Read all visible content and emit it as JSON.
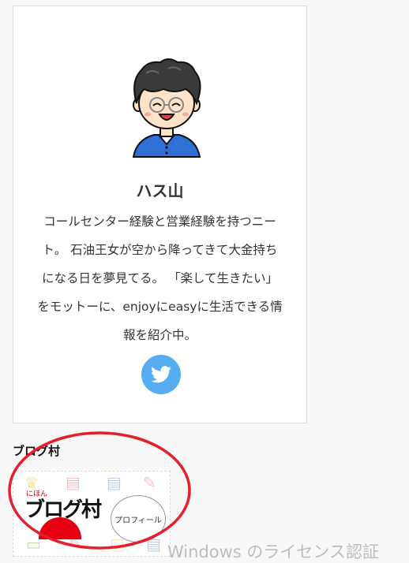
{
  "profile": {
    "name": "ハス山",
    "bio_lines": [
      "コールセンター経験と営業経験を持つニー",
      "ト。 石油王女が空から降ってきて大金持ち",
      "になる日を夢見てる。 「楽して生きたい」",
      "をモットーに、enjoyにeasyに生活できる情",
      "報を紹介中。"
    ],
    "twitter_icon": "twitter-bird-icon"
  },
  "widget": {
    "title": "ブログ村",
    "banner": {
      "brand_small": "にほん",
      "brand": "ブログ村",
      "bubble": "プロフィール"
    }
  },
  "watermark": "Windows のライセンス認証",
  "colors": {
    "twitter": "#55acee",
    "annotation_ring": "#e3202c",
    "blogmura_red": "#e60012"
  }
}
